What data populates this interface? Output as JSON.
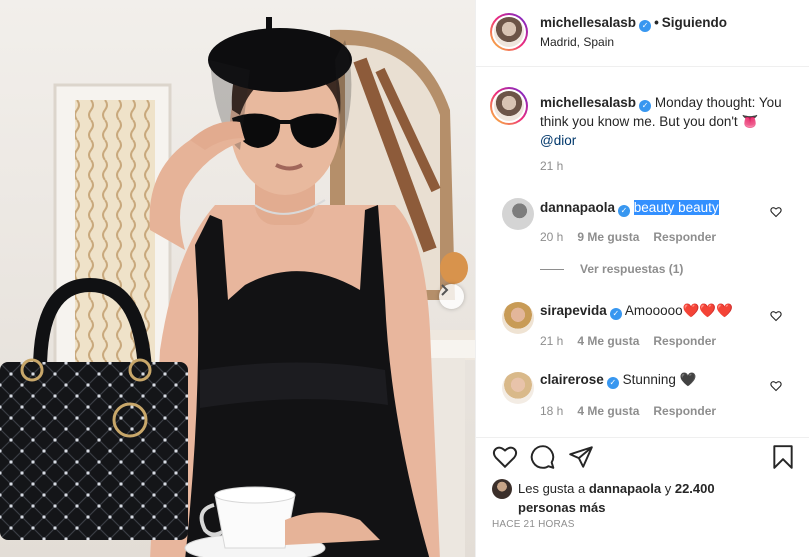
{
  "header": {
    "username": "michellesalasb",
    "separator": "•",
    "follow_status": "Siguiendo",
    "location": "Madrid, Spain"
  },
  "caption": {
    "username": "michellesalasb",
    "text": "Monday thought: You think you know me. But you don't",
    "emoji": "👅",
    "mention": "@dior",
    "time": "21 h"
  },
  "comments": [
    {
      "username": "dannapaola",
      "text": "beauty beauty",
      "time": "20 h",
      "likes": "9 Me gusta",
      "reply": "Responder",
      "view_replies": "Ver respuestas (1)"
    },
    {
      "username": "sirapevida",
      "text": "Amooooo",
      "emoji": "❤️❤️❤️",
      "time": "21 h",
      "likes": "4 Me gusta",
      "reply": "Responder"
    },
    {
      "username": "clairerose",
      "text": "Stunning",
      "emoji": "🖤",
      "time": "18 h",
      "likes": "4 Me gusta",
      "reply": "Responder"
    }
  ],
  "likes": {
    "prefix": "Les gusta a",
    "user": "dannapaola",
    "suffix": "y",
    "others": "22.400 personas más"
  },
  "posted": "HACE 21 HORAS",
  "icons": {
    "like": "heart-icon",
    "comment": "comment-icon",
    "share": "share-icon",
    "save": "bookmark-icon",
    "next": "chevron-right-icon",
    "verified": "verified-badge-icon"
  },
  "colors": {
    "verified": "#3897f0",
    "mention": "#00376b",
    "highlight": "#3390ff",
    "muted": "#8e8e8e"
  }
}
